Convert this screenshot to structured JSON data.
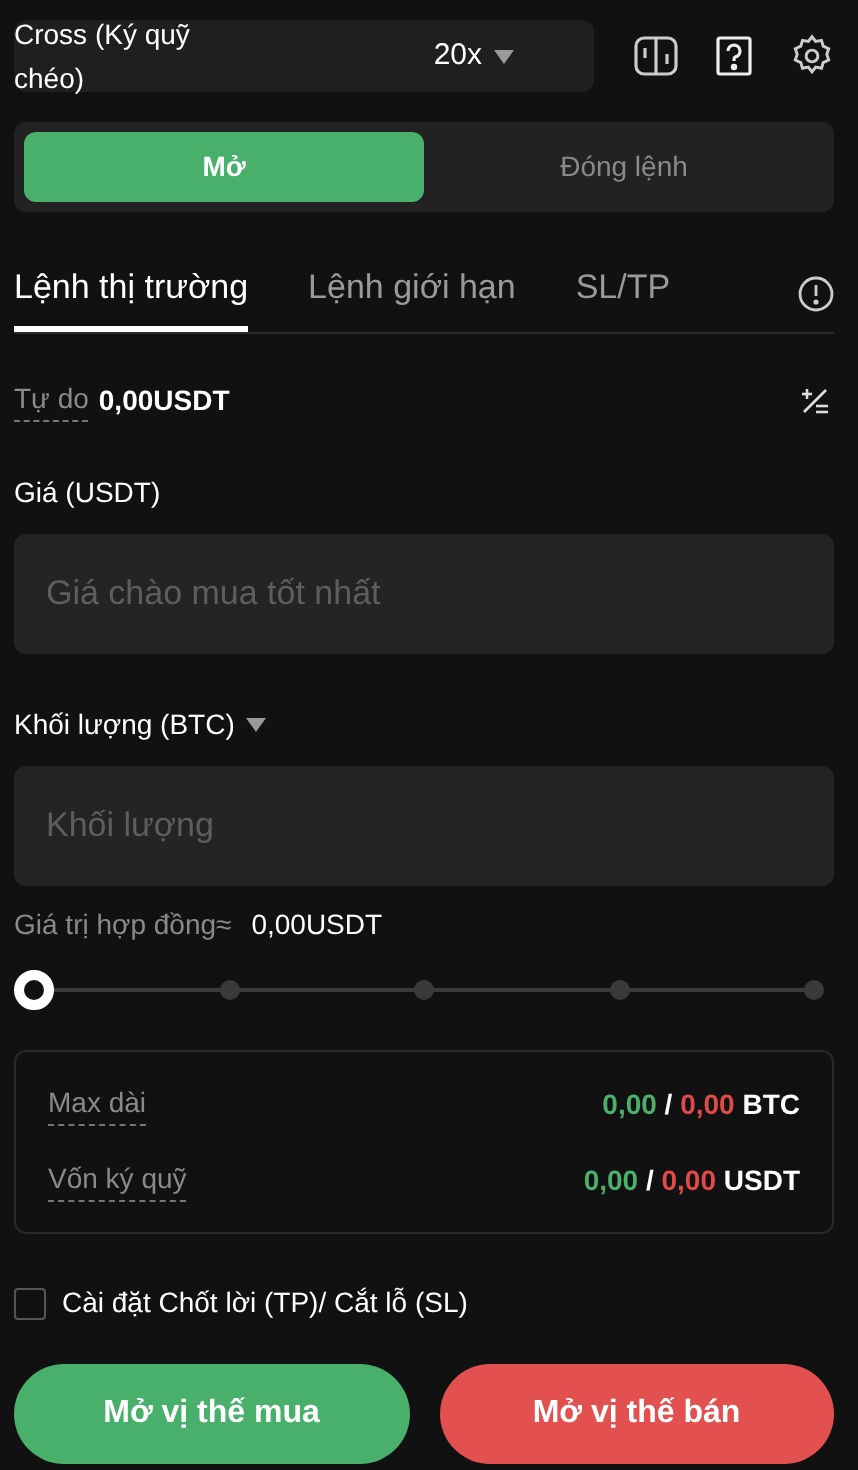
{
  "margin_mode": {
    "label": "Cross (Ký quỹ chéo)",
    "leverage": "20x"
  },
  "side_tabs": [
    {
      "label": "Mở",
      "selected": true
    },
    {
      "label": "Đóng lệnh",
      "selected": false
    }
  ],
  "order_tabs": [
    {
      "label": "Lệnh thị trường",
      "selected": true
    },
    {
      "label": "Lệnh giới hạn",
      "selected": false
    },
    {
      "label": "SL/TP",
      "selected": false
    }
  ],
  "available": {
    "label": "Tự do",
    "value": "0,00USDT"
  },
  "price": {
    "label": "Giá (USDT)",
    "placeholder": "Giá chào mua tốt nhất"
  },
  "amount": {
    "label": "Khối lượng (BTC)",
    "placeholder": "Khối lượng"
  },
  "contract_value": {
    "label": "Giá trị hợp đồng≈",
    "value": "0,00USDT"
  },
  "slider": {
    "level": 0
  },
  "summary": [
    {
      "label": "Max dài",
      "long": "0,00",
      "separator": "/",
      "short": "0,00",
      "unit": "BTC"
    },
    {
      "label": "Vốn ký quỹ",
      "long": "0,00",
      "separator": "/",
      "short": "0,00",
      "unit": "USDT"
    }
  ],
  "tp_sl": {
    "label": "Cài đặt Chốt lời (TP)/ Cắt lỗ (SL)",
    "checked": false
  },
  "buttons": [
    {
      "kind": "buy",
      "label": "Mở vị thế mua"
    },
    {
      "kind": "sell",
      "label": "Mở vị thế bán"
    }
  ]
}
